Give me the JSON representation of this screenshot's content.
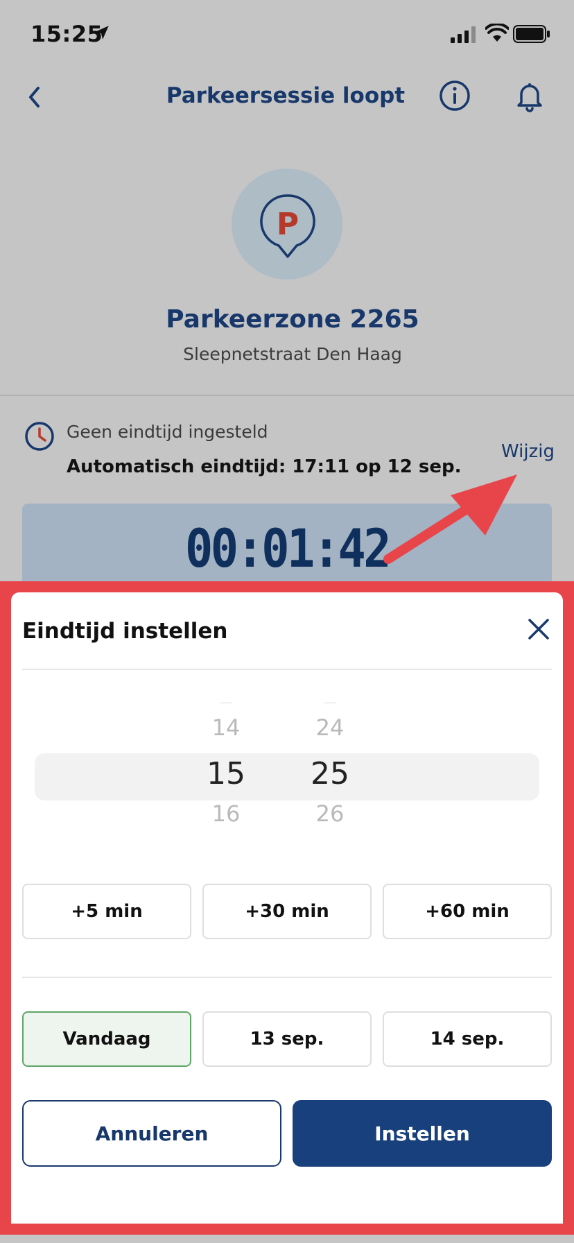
{
  "status_bar": {
    "time": "15:25",
    "icons": [
      "location-arrow-icon",
      "signal-icon",
      "wifi-icon",
      "battery-icon"
    ]
  },
  "nav": {
    "title": "Parkeersessie loopt",
    "icons": [
      "chevron-left-icon",
      "info-icon",
      "bell-icon"
    ]
  },
  "zone": {
    "pin_letter": "P",
    "title": "Parkeerzone 2265",
    "address": "Sleepnetstraat Den Haag"
  },
  "session": {
    "no_end_text": "Geen eindtijd ingesteld",
    "auto_end_text": "Automatisch eindtijd: 17:11 op 12 sep.",
    "edit_label": "Wijzig",
    "timer": "00:01:42"
  },
  "sheet": {
    "title": "Eindtijd instellen",
    "picker": {
      "hours": {
        "prev": "14",
        "selected": "15",
        "next": "16"
      },
      "minutes": {
        "prev": "24",
        "selected": "25",
        "next": "26"
      }
    },
    "increments": [
      "+5 min",
      "+30 min",
      "+60 min"
    ],
    "days": [
      {
        "label": "Vandaag",
        "selected": true
      },
      {
        "label": "13 sep.",
        "selected": false
      },
      {
        "label": "14 sep.",
        "selected": false
      }
    ],
    "cancel_label": "Annuleren",
    "confirm_label": "Instellen"
  },
  "colors": {
    "primary": "#18386b",
    "primary_button": "#18407c",
    "highlight_frame": "#e8454b",
    "selected_day_border": "#5ea666",
    "pin_letter": "#b53a2b"
  }
}
